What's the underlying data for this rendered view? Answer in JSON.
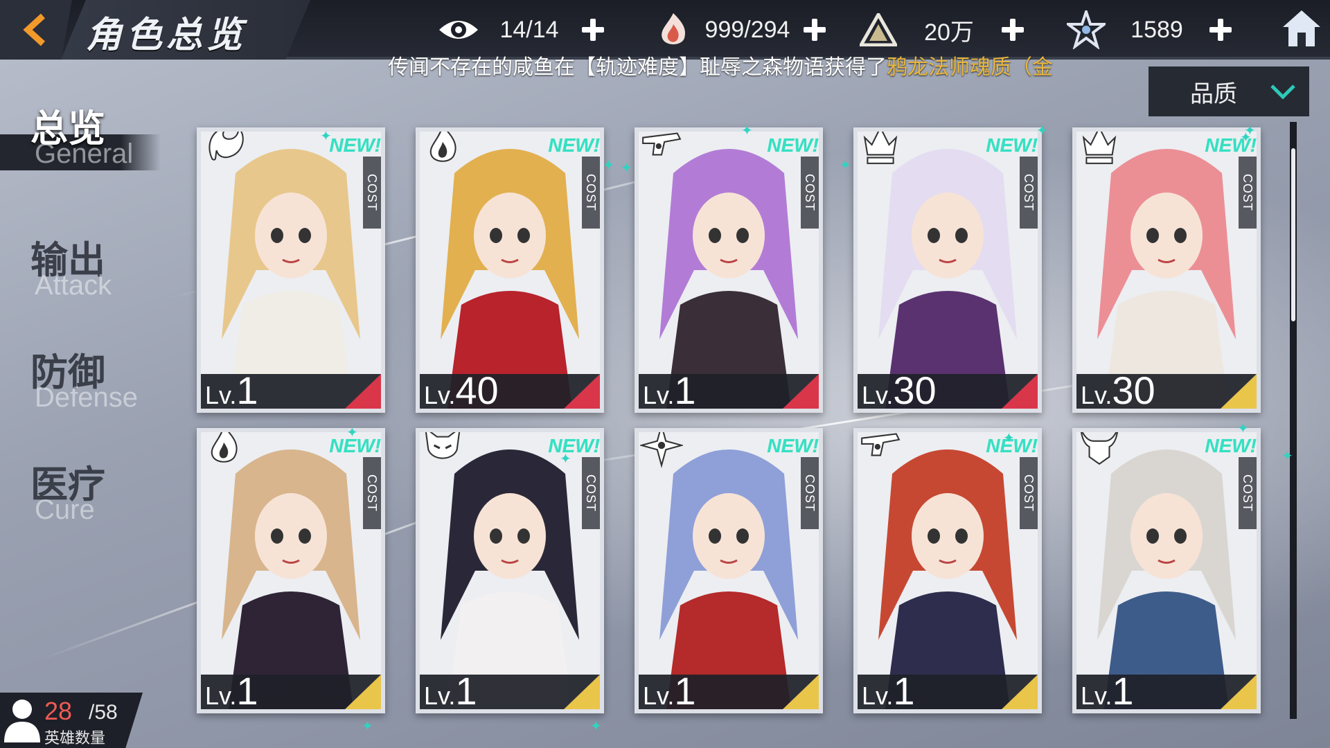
{
  "header": {
    "title": "角色总览",
    "resources": [
      {
        "icon": "eye-icon",
        "value": "14/14"
      },
      {
        "icon": "flame-hand-icon",
        "value": "999/294"
      },
      {
        "icon": "triangle-crystal-icon",
        "value": "20万"
      },
      {
        "icon": "star-emblem-icon",
        "value": "1589"
      }
    ]
  },
  "marquee": {
    "text": "传闻不存在的咸鱼在【轨迹难度】耻辱之森物语获得了",
    "highlight": "鸦龙法师魂质（金"
  },
  "sort": {
    "label": "品质"
  },
  "nav": [
    {
      "zh": "总览",
      "en": "General"
    },
    {
      "zh": "输出",
      "en": "Attack"
    },
    {
      "zh": "防御",
      "en": "Defense"
    },
    {
      "zh": "医疗",
      "en": "Cure"
    }
  ],
  "cards": [
    {
      "class_icon": "dragon-class-icon",
      "new": "NEW!",
      "cost": "COST",
      "lv_prefix": "Lv.",
      "level": "1",
      "corner": "#d9364a",
      "hair": "#e8c78c",
      "outfit": "#f0ede6"
    },
    {
      "class_icon": "flame-class-icon",
      "new": "NEW!",
      "cost": "COST",
      "lv_prefix": "Lv.",
      "level": "40",
      "corner": "#d9364a",
      "hair": "#e2b04f",
      "outfit": "#b8232c"
    },
    {
      "class_icon": "gun-class-icon",
      "new": "NEW!",
      "cost": "COST",
      "lv_prefix": "Lv.",
      "level": "1",
      "corner": "#d9364a",
      "hair": "#b27cd6",
      "outfit": "#3a2e38"
    },
    {
      "class_icon": "crown-class-icon",
      "new": "NEW!",
      "cost": "COST",
      "lv_prefix": "Lv.",
      "level": "30",
      "corner": "#d9364a",
      "hair": "#e4dcf0",
      "outfit": "#5a3270"
    },
    {
      "class_icon": "crown-class-icon",
      "new": "NEW!",
      "cost": "COST",
      "lv_prefix": "Lv.",
      "level": "30",
      "corner": "#e9c54a",
      "hair": "#ec8f95",
      "outfit": "#ede7df"
    },
    {
      "class_icon": "flame-class-icon",
      "new": "NEW!",
      "cost": "COST",
      "lv_prefix": "Lv.",
      "level": "1",
      "corner": "#e9c54a",
      "hair": "#d8b58c",
      "outfit": "#2f2436"
    },
    {
      "class_icon": "fox-mask-class-icon",
      "new": "NEW!",
      "cost": "COST",
      "lv_prefix": "Lv.",
      "level": "1",
      "corner": "#e9c54a",
      "hair": "#2a2838",
      "outfit": "#f2f0f0"
    },
    {
      "class_icon": "shuriken-class-icon",
      "new": "NEW!",
      "cost": "COST",
      "lv_prefix": "Lv.",
      "level": "1",
      "corner": "#e9c54a",
      "hair": "#8f9fd8",
      "outfit": "#b52a2a"
    },
    {
      "class_icon": "gun-class-icon",
      "new": "NEW!",
      "cost": "COST",
      "lv_prefix": "Lv.",
      "level": "1",
      "corner": "#e9c54a",
      "hair": "#c74832",
      "outfit": "#2f2d4d"
    },
    {
      "class_icon": "horned-class-icon",
      "new": "NEW!",
      "cost": "COST",
      "lv_prefix": "Lv.",
      "level": "1",
      "corner": "#e9c54a",
      "hair": "#d9d6d2",
      "outfit": "#3e5c8a"
    }
  ],
  "hero_count": {
    "current": "28",
    "max": "/58",
    "label": "英雄数量"
  }
}
